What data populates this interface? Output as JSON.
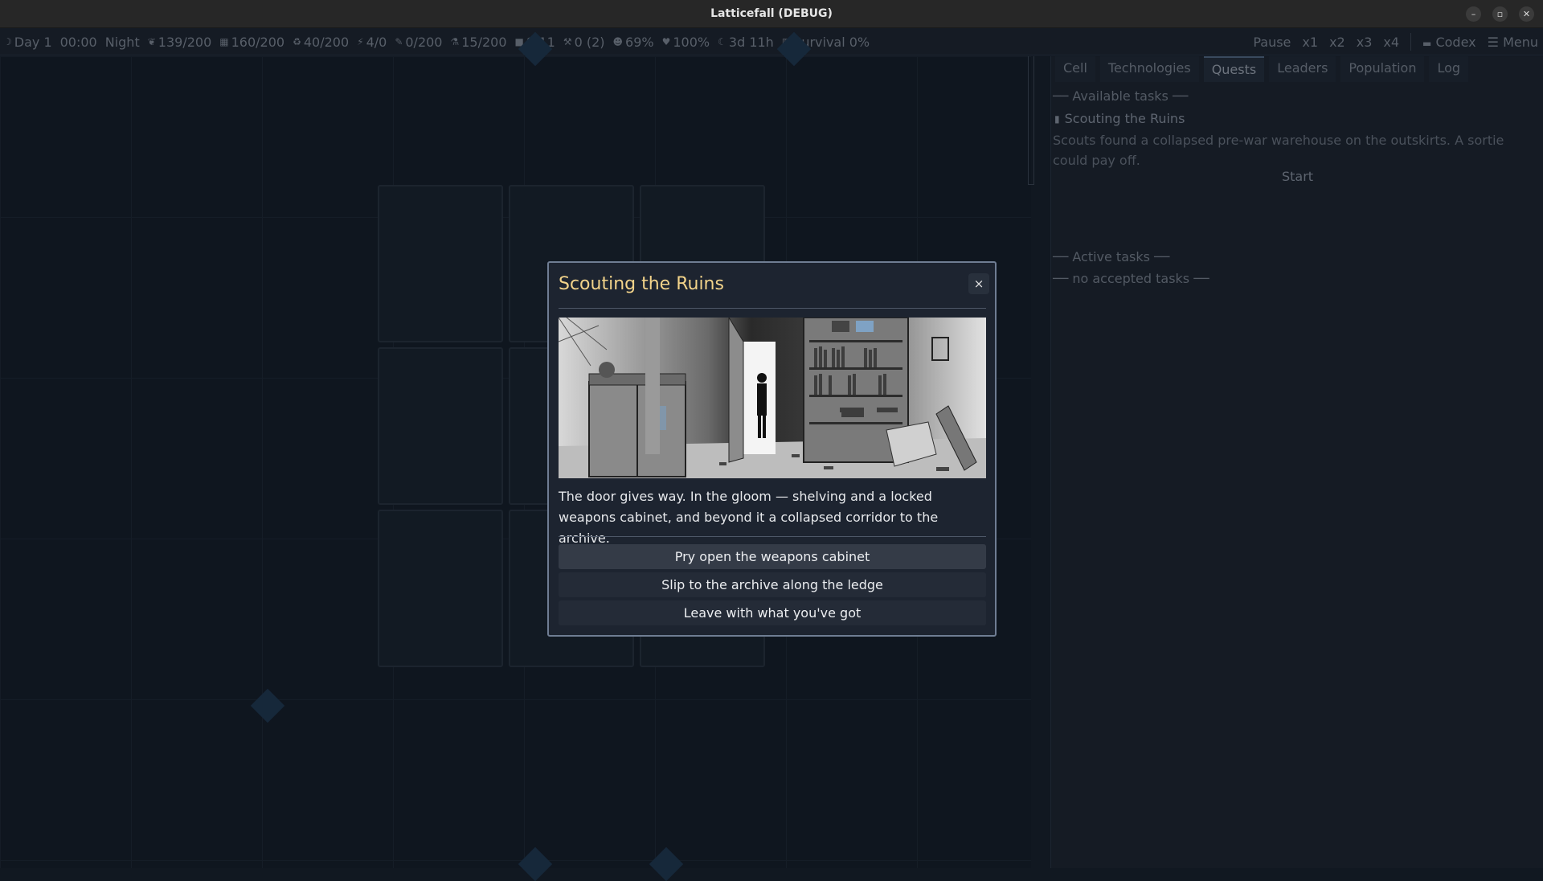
{
  "window": {
    "title": "Latticefall (DEBUG)",
    "minimize_icon": "minimize-icon",
    "maximize_icon": "maximize-icon",
    "close_icon": "close-icon"
  },
  "hud": {
    "items": [
      {
        "icon": "moon-icon",
        "glyph": "☽",
        "text": "Day 1"
      },
      {
        "icon": "",
        "glyph": "",
        "text": "00:00"
      },
      {
        "icon": "",
        "glyph": "",
        "text": "Night"
      },
      {
        "icon": "leaf-icon",
        "glyph": "❦",
        "text": "139/200"
      },
      {
        "icon": "brick-icon",
        "glyph": "▦",
        "text": "160/200"
      },
      {
        "icon": "recycle-icon",
        "glyph": "♻",
        "text": "40/200"
      },
      {
        "icon": "lightning-icon",
        "glyph": "⚡",
        "text": "4/0"
      },
      {
        "icon": "pill-icon",
        "glyph": "✎",
        "text": "0/200"
      },
      {
        "icon": "flask-icon",
        "glyph": "⚗",
        "text": "15/200"
      },
      {
        "icon": "people-icon",
        "glyph": "■",
        "text": "8/11"
      },
      {
        "icon": "tools-icon",
        "glyph": "⚒",
        "text": "0 (2)"
      },
      {
        "icon": "smile-icon",
        "glyph": "☻",
        "text": "69%"
      },
      {
        "icon": "heart-icon",
        "glyph": "♥",
        "text": "100%"
      },
      {
        "icon": "hourglass-icon",
        "glyph": "☾",
        "text": "3d 11h"
      },
      {
        "icon": "shield-icon",
        "glyph": "▥",
        "text": "Survival 0%"
      }
    ],
    "controls": {
      "pause": "Pause",
      "speeds": [
        "x1",
        "x2",
        "x3",
        "x4"
      ],
      "codex": "Codex",
      "menu": "Menu"
    }
  },
  "panel": {
    "tabs": [
      "Cell",
      "Technologies",
      "Quests",
      "Leaders",
      "Population",
      "Log"
    ],
    "active_tab": "Quests",
    "available_header": "── Available tasks ──",
    "quest": {
      "name": "Scouting the Ruins",
      "description": "Scouts found a collapsed pre-war warehouse on the outskirts. A sortie could pay off.",
      "start": "Start"
    },
    "active_header": "── Active tasks ──",
    "no_tasks": "── no accepted tasks ──"
  },
  "modal": {
    "title": "Scouting the Ruins",
    "close": "×",
    "image_alt_icon": "ruins-illustration",
    "text": "The door gives way. In the gloom — shelving and a locked weapons cabinet, and beyond it a collapsed corridor to the archive.",
    "choices": [
      "Pry open the weapons cabinet",
      "Slip to the archive along the ledge",
      "Leave with what you've got"
    ]
  },
  "colors": {
    "title_accent": "#f2d38a",
    "modal_border": "#6f7d93",
    "background": "#111821"
  }
}
